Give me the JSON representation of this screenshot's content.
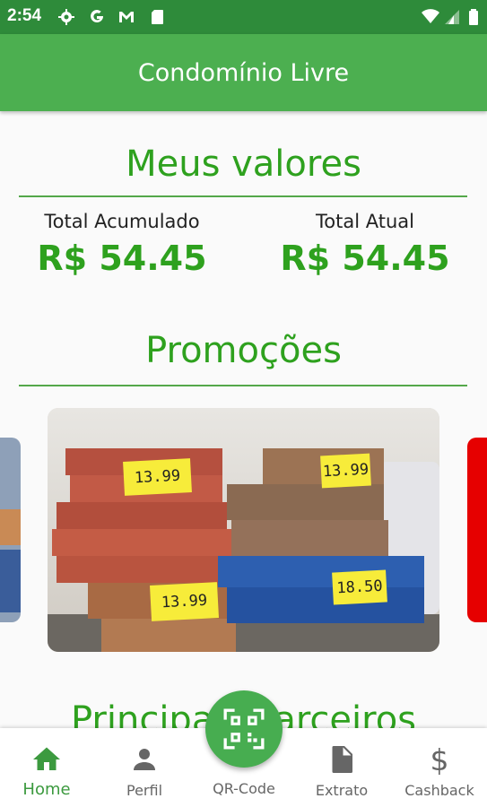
{
  "status_bar": {
    "time": "2:54",
    "left_icons": [
      "gear-icon",
      "google-icon",
      "gmail-icon",
      "sd-card-icon"
    ],
    "right_icons": [
      "wifi-icon",
      "signal-icon",
      "battery-icon"
    ]
  },
  "app_bar": {
    "title": "Condomínio Livre"
  },
  "values_section": {
    "title": "Meus valores",
    "accumulated": {
      "label": "Total Acumulado",
      "amount": "R$ 54.45"
    },
    "current": {
      "label": "Total Atual",
      "amount": "R$ 54.45"
    }
  },
  "promotions_section": {
    "title": "Promoções",
    "price_tags": [
      "13.99",
      "13.99",
      "13.99",
      "18.50"
    ]
  },
  "partners_section": {
    "title": "Principais Parceiros"
  },
  "bottom_nav": {
    "items": [
      {
        "label": "Home",
        "icon": "home-icon",
        "active": true
      },
      {
        "label": "Perfil",
        "icon": "person-icon",
        "active": false
      },
      {
        "label": "QR-Code",
        "icon": "qr-code-icon",
        "active": false
      },
      {
        "label": "Extrato",
        "icon": "document-icon",
        "active": false
      },
      {
        "label": "Cashback",
        "icon": "dollar-icon",
        "active": false
      }
    ]
  },
  "colors": {
    "status_bar": "#2e8b3a",
    "app_bar": "#4caf50",
    "accent_green": "#2ea11e",
    "fab": "#47ad50",
    "nav_active": "#3c9a3f",
    "side_card_red": "#e60000"
  }
}
